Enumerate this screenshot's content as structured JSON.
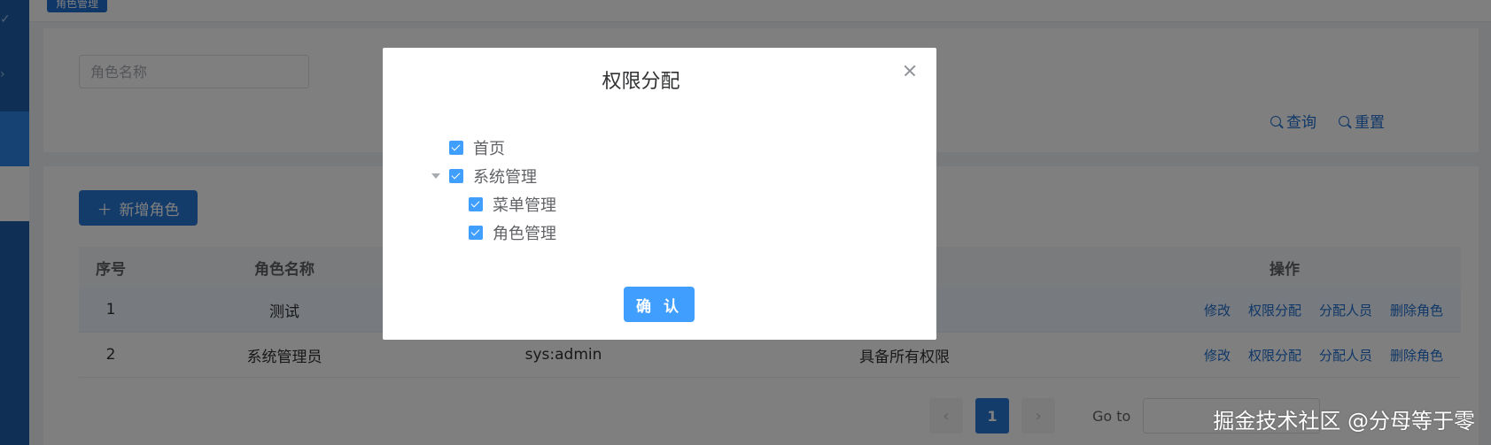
{
  "app": {
    "active_tag": "角色管理"
  },
  "search": {
    "placeholder": "角色名称",
    "query_label": "查询",
    "reset_label": "重置"
  },
  "toolbar": {
    "add_label": "新增角色"
  },
  "table": {
    "headers": {
      "index": "序号",
      "name": "角色名称",
      "operations": "操作"
    },
    "rows": [
      {
        "index": "1",
        "name": "测试",
        "key": "",
        "remark": "",
        "ops": [
          "修改",
          "权限分配",
          "分配人员",
          "删除角色"
        ]
      },
      {
        "index": "2",
        "name": "系统管理员",
        "key": "sys:admin",
        "remark": "具备所有权限",
        "ops": [
          "修改",
          "权限分配",
          "分配人员",
          "删除角色"
        ]
      }
    ]
  },
  "pagination": {
    "current_page": "1",
    "goto_label": "Go to"
  },
  "dialog": {
    "title": "权限分配",
    "tree": [
      {
        "label": "首页",
        "checked": true
      },
      {
        "label": "系统管理",
        "checked": true,
        "expanded": true,
        "children": [
          {
            "label": "菜单管理",
            "checked": true
          },
          {
            "label": "角色管理",
            "checked": true
          }
        ]
      }
    ],
    "confirm_label": "确 认"
  },
  "watermark": "掘金技术社区 @分母等于零",
  "colors": {
    "primary": "#409eff",
    "sidebar": "#1f5fa8",
    "link": "#1f6fd1"
  }
}
